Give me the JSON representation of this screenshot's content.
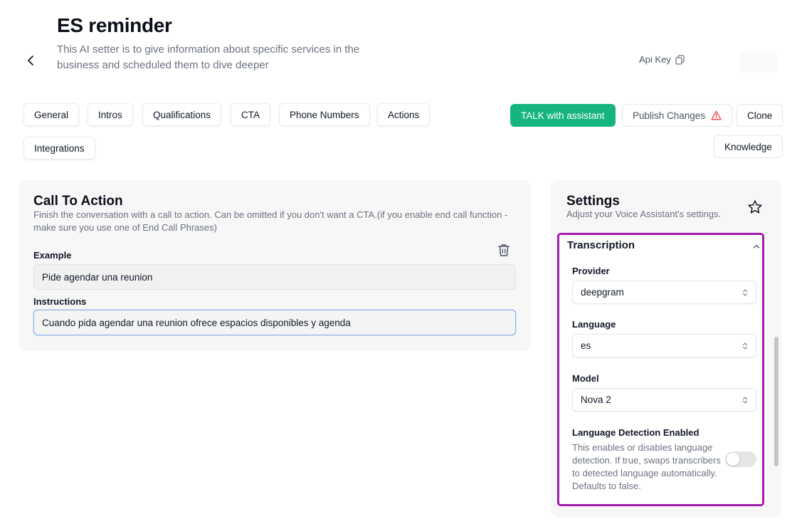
{
  "header": {
    "title": "ES reminder",
    "subtitle": "This AI setter is to give information about specific services in the business and scheduled them to dive deeper",
    "api_key_label": "Api Key"
  },
  "tabs": [
    {
      "label": "General"
    },
    {
      "label": "Intros"
    },
    {
      "label": "Qualifications"
    },
    {
      "label": "CTA"
    },
    {
      "label": "Phone Numbers"
    },
    {
      "label": "Actions"
    },
    {
      "label": "Integrations"
    }
  ],
  "actions": {
    "talk": "TALK with assistant",
    "publish": "Publish Changes",
    "clone": "Clone",
    "knowledge": "Knowledge"
  },
  "cta": {
    "title": "Call To Action",
    "description": "Finish the conversation with a call to action. Can be omitted if you don't want a CTA.(if you enable end call function - make sure you use one of End Call Phrases)",
    "example_label": "Example",
    "example_value": "Pide agendar una reunion",
    "instructions_label": "Instructions",
    "instructions_value": "Cuando pida agendar una reunion ofrece espacios disponibles y agenda"
  },
  "settings": {
    "title": "Settings",
    "subtitle": "Adjust your Voice Assistant's settings.",
    "section": "Transcription",
    "provider_label": "Provider",
    "provider_value": "deepgram",
    "language_label": "Language",
    "language_value": "es",
    "model_label": "Model",
    "model_value": "Nova 2",
    "language_detection_label": "Language Detection Enabled",
    "language_detection_desc": "This enables or disables language detection. If true, swaps transcribers to detected language automatically. Defaults to false.",
    "language_detection_enabled": false
  },
  "colors": {
    "accent_green": "#16b57f",
    "warning": "#ef4444",
    "highlight_border": "#a21caf"
  }
}
